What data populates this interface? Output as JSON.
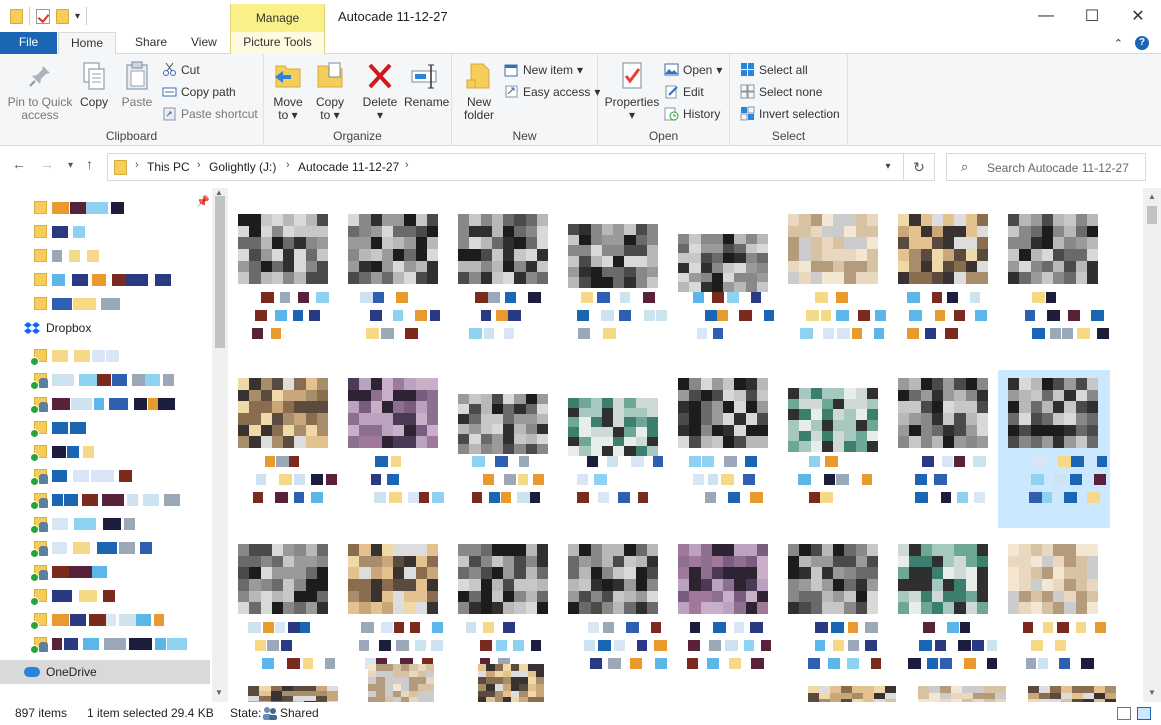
{
  "window": {
    "title": "Autocade 11-12-27",
    "context_tab": "Manage",
    "controls": {
      "minimize": "—",
      "maximize": "☐",
      "close": "✕"
    }
  },
  "tabs": {
    "file": "File",
    "home": "Home",
    "share": "Share",
    "view": "View",
    "picture_tools": "Picture Tools"
  },
  "ribbon": {
    "clipboard": {
      "label": "Clipboard",
      "pin": "Pin to Quick access",
      "copy": "Copy",
      "paste": "Paste",
      "cut": "Cut",
      "copy_path": "Copy path",
      "paste_shortcut": "Paste shortcut"
    },
    "organize": {
      "label": "Organize",
      "move_to": "Move to",
      "copy_to": "Copy to",
      "delete": "Delete",
      "rename": "Rename"
    },
    "new": {
      "label": "New",
      "new_folder": "New folder",
      "new_item": "New item",
      "easy_access": "Easy access"
    },
    "open": {
      "label": "Open",
      "properties": "Properties",
      "open": "Open",
      "edit": "Edit",
      "history": "History"
    },
    "select": {
      "label": "Select",
      "select_all": "Select all",
      "select_none": "Select none",
      "invert_selection": "Invert selection"
    }
  },
  "address": {
    "crumbs": [
      "This PC",
      "Golightly (J:)",
      "Autocade 11-12-27"
    ],
    "search_placeholder": "Search Autocade 11-12-27"
  },
  "nav": {
    "dropbox": "Dropbox",
    "onedrive": "OneDrive"
  },
  "status": {
    "items": "897 items",
    "selected": "1 item selected",
    "size": "29.4 KB",
    "state_label": "State:",
    "state_value": "Shared"
  },
  "colors": {
    "accent": "#1a66b5",
    "context": "#f9f08a",
    "selection": "#cce8ff"
  }
}
